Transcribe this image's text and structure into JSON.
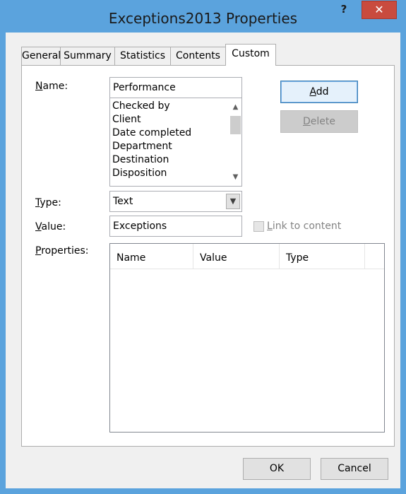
{
  "window": {
    "title": "Exceptions2013 Properties",
    "help_label": "?",
    "close_label": "✕",
    "frame_color": "#5ba3dd",
    "close_color": "#c94b3e"
  },
  "tabs": [
    {
      "label": "General",
      "active": false
    },
    {
      "label": "Summary",
      "active": false
    },
    {
      "label": "Statistics",
      "active": false
    },
    {
      "label": "Contents",
      "active": false
    },
    {
      "label": "Custom",
      "active": true
    }
  ],
  "form": {
    "name_label_mnemonic": "N",
    "name_label_rest": "ame:",
    "name_value": "Performance",
    "name_list": [
      "Checked by",
      "Client",
      "Date completed",
      "Department",
      "Destination",
      "Disposition"
    ],
    "type_label_mnemonic": "T",
    "type_label_rest": "ype:",
    "type_value": "Text",
    "value_label_mnemonic": "V",
    "value_label_rest": "alue:",
    "value_value": "Exceptions",
    "link_label_mnemonic": "L",
    "link_label_rest": "ink to content",
    "properties_label_mnemonic": "P",
    "properties_label_rest": "roperties:"
  },
  "buttons": {
    "add_mnemonic": "A",
    "add_rest": "dd",
    "delete_mnemonic": "D",
    "delete_rest": "elete",
    "ok": "OK",
    "cancel": "Cancel"
  },
  "properties_table": {
    "columns": [
      "Name",
      "Value",
      "Type"
    ],
    "rows": []
  },
  "icons": {
    "scroll_up": "chevron-up-icon",
    "scroll_down": "chevron-down-icon",
    "combo_drop": "chevron-down-icon",
    "close": "close-icon",
    "help": "help-icon"
  }
}
